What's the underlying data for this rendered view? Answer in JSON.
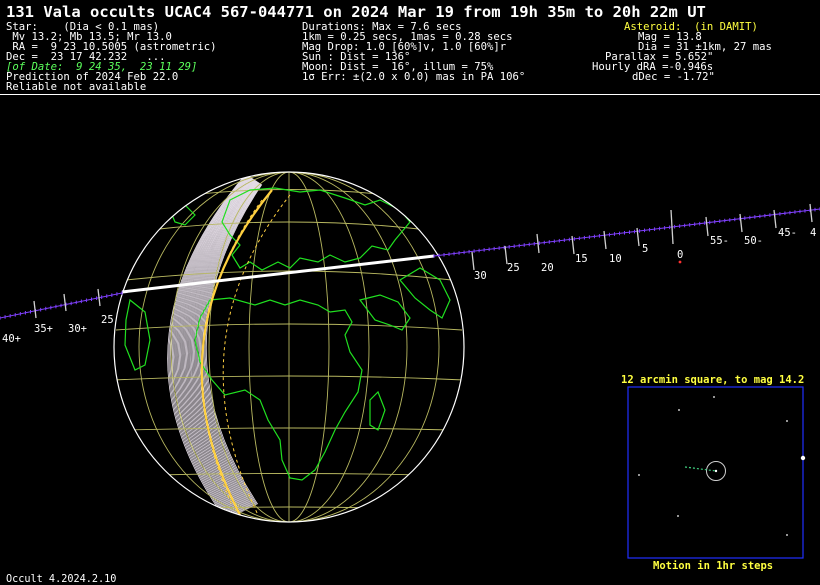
{
  "title": "131 Vala occults UCAC4 567-044771 on 2024 Mar 19 from 19h 35m to 20h 22m UT",
  "star": {
    "line1": "Star:    (Dia < 0.1 mas)",
    "line2": " Mv 13.2; Mb 13.5; Mr 13.0",
    "line3": " RA =  9 23 10.5005 (astrometric)",
    "line4": "Dec =  23 17 42.232   ...",
    "line5": "[of Date:  9 24 35,  23 11 29]",
    "line6": "Prediction of 2024 Feb 22.0",
    "line7": "Reliable not available"
  },
  "event": {
    "line1": "Durations: Max = 7.6 secs",
    "line2": "1km = 0.25 secs, 1mas = 0.28 secs",
    "line3": "Mag Drop: 1.0 [60%]v, 1.0 [60%]r",
    "line4": "Sun : Dist = 136°",
    "line5": "Moon: Dist =  16°, illum = 75%",
    "line6": "1σ Err: ±(2.0 x 0.0) mas in PA 106°"
  },
  "asteroid": {
    "line1": "Asteroid:  (in DAMIT)",
    "line2": "Mag = 13.8",
    "line3": "Dia = 31 ±1km, 27 mas",
    "line4": "Parallax = 5.652\"",
    "line5": "Hourly dRA =-0.946s",
    "line6": "dDec = -1.72\""
  },
  "path_labels": [
    "40+",
    "35+",
    "30+",
    "25",
    "30",
    "25",
    "20",
    "15",
    "10",
    "5",
    "0",
    "55-",
    "50-",
    "45-",
    "4"
  ],
  "inset": {
    "title": "12 arcmin square, to mag 14.2",
    "footer": "Motion in 1hr steps"
  },
  "footer": "Occult 4.2024.2.10",
  "colors": {
    "background": "#000000",
    "globe_grid": "#b8b860",
    "coastline": "#20e020",
    "path": "#8040ff",
    "night_limb": "#ffd040",
    "inset_border": "#2030ff",
    "header_highlight": "#ffff40"
  }
}
